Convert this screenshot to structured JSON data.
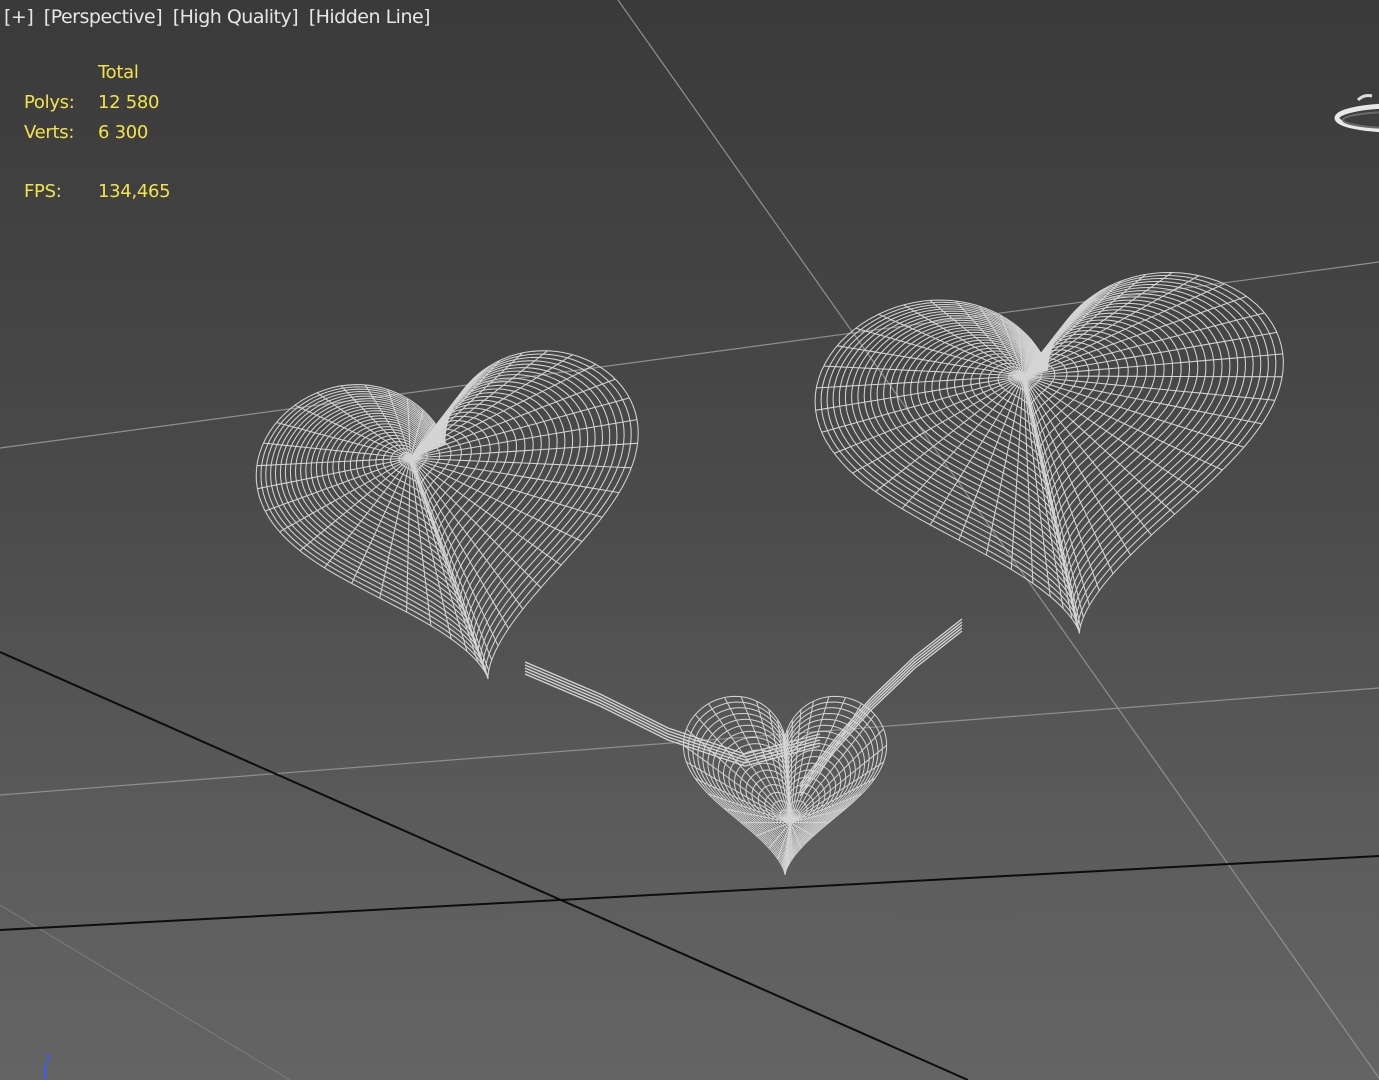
{
  "viewport": {
    "labels": [
      "[+]",
      "[Perspective]",
      "[High Quality]",
      "[Hidden Line]"
    ]
  },
  "stats": {
    "header": "Total",
    "polys_label": "Polys:",
    "polys_value": "12 580",
    "verts_label": "Verts:",
    "verts_value": "6 300",
    "fps_label": "FPS:",
    "fps_value": "134,465"
  },
  "axis": {
    "z_label": "z"
  },
  "colors": {
    "stats_text": "#f2e34c",
    "wireframe": "#d4d4d4",
    "grid_line": "#8a8a8a",
    "world_axis": "#0d0d0d",
    "axis_z": "#3a5cff"
  },
  "icons": {
    "viewcube": "viewcube-ring-icon"
  }
}
